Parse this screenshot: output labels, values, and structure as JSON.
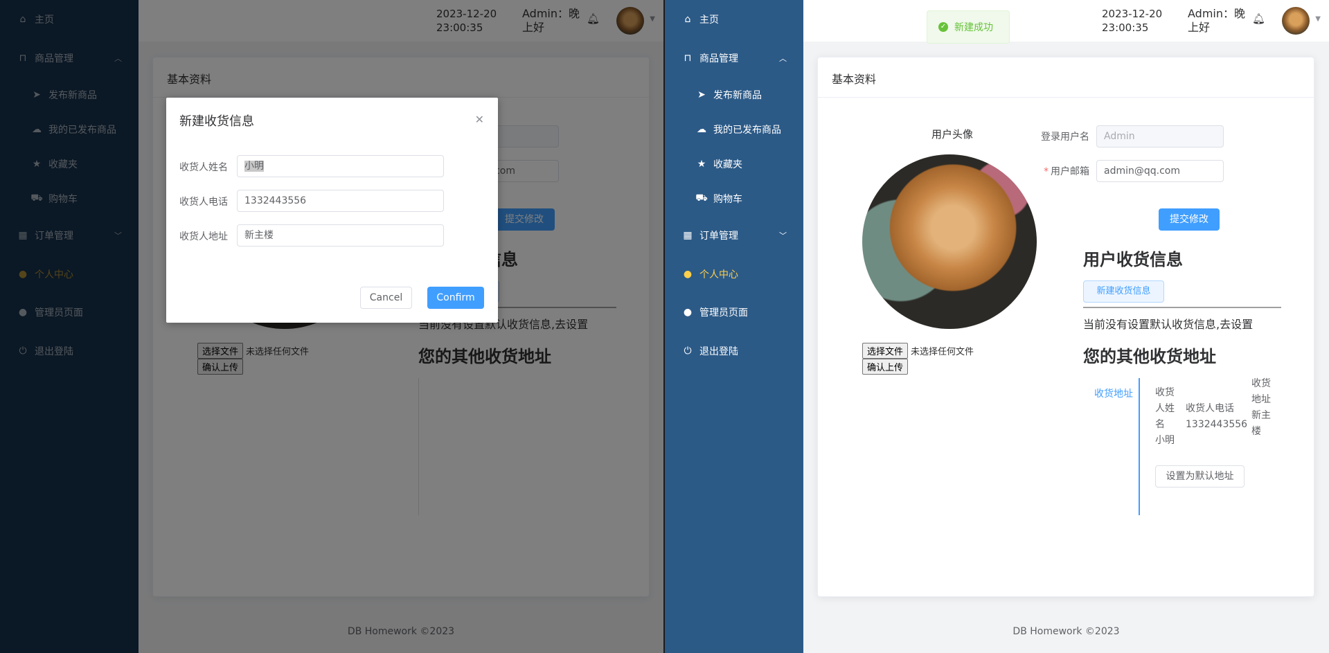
{
  "menu": {
    "home": "主页",
    "goods": "商品管理",
    "publish": "发布新商品",
    "my_published": "我的已发布商品",
    "favorites": "收藏夹",
    "cart": "购物车",
    "orders": "订单管理",
    "personal": "个人中心",
    "admin": "管理员页面",
    "logout": "退出登陆"
  },
  "header": {
    "date": "2023-12-20",
    "time": "23:00:35",
    "greeting": "Admin：晚上好"
  },
  "card": {
    "title": "基本资料",
    "avatar_label": "用户头像",
    "choose_file": "选择文件",
    "no_file": "未选择任何文件",
    "confirm_upload": "确认上传",
    "username_label": "登录用户名",
    "username_value": "Admin",
    "email_label": "用户邮箱",
    "email_value": "admin@qq.com",
    "submit": "提交修改",
    "shipping_title": "用户收货信息",
    "new_shipping": "新建收货信息",
    "no_default": "当前没有设置默认收货信息,去设置",
    "other_title": "您的其他收货地址",
    "tab_label": "收货地址",
    "col_name_header": "收货人姓名",
    "col_phone_header": "收货人电话",
    "col_addr_header": "收货地址",
    "col_name_value": "小明",
    "col_phone_value": "1332443556",
    "col_addr_value": "新主楼",
    "set_default": "设置为默认地址"
  },
  "dialog": {
    "title": "新建收货信息",
    "name_label": "收货人姓名",
    "name_value": "小明",
    "phone_label": "收货人电话",
    "phone_value": "1332443556",
    "addr_label": "收货人地址",
    "addr_value": "新主楼",
    "cancel": "Cancel",
    "confirm": "Confirm"
  },
  "toast": {
    "message": "新建成功"
  },
  "footer": "DB Homework ©2023",
  "icons": [
    "home-icon",
    "bag-icon",
    "send-icon",
    "cloud-upload-icon",
    "star-icon",
    "cart-icon",
    "calendar-icon",
    "user-icon",
    "power-icon",
    "bell-icon",
    "success-icon",
    "close-icon"
  ],
  "colors": {
    "primary": "#409eff",
    "sidebar": "#2c5a87",
    "active": "#ffd04b",
    "success": "#67c23a"
  }
}
